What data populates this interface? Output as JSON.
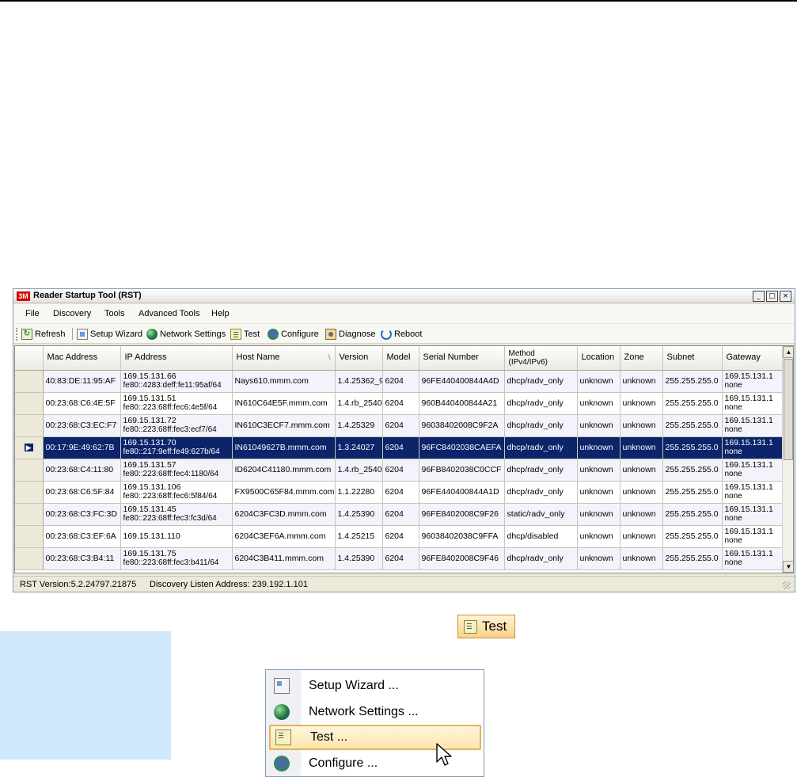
{
  "window": {
    "title": "Reader Startup Tool (RST)",
    "logo_text": "3M",
    "controls": {
      "minimize": "_",
      "maximize": "□",
      "close": "×"
    }
  },
  "menu": [
    "File",
    "Discovery",
    "Tools",
    "Advanced Tools",
    "Help"
  ],
  "toolbar": {
    "refresh": "Refresh",
    "setup_wizard": "Setup Wizard",
    "network_settings": "Network Settings",
    "test": "Test",
    "configure": "Configure",
    "diagnose": "Diagnose",
    "reboot": "Reboot"
  },
  "columns": [
    "Mac Address",
    "IP Address",
    "Host Name",
    "Version",
    "Model",
    "Serial Number",
    "Method (IPv4/IPv6)",
    "Location",
    "Zone",
    "Subnet",
    "Gateway"
  ],
  "rows": [
    {
      "mac": "40:83:DE:11:95:AF",
      "ip1": "169.15.131.66",
      "ip2": "fe80::4283:deff:fe11:95af/64",
      "host": "Nays610.mmm.com",
      "version": "1.4.25362_9",
      "model": "6204",
      "serial": "96FE440400844A4D",
      "method": "dhcp/radv_only",
      "location": "unknown",
      "zone": "unknown",
      "subnet": "255.255.255.0",
      "gw1": "169.15.131.1",
      "gw2": "none"
    },
    {
      "mac": "00:23:68:C6:4E:5F",
      "ip1": "169.15.131.51",
      "ip2": "fe80::223:68ff:fec6:4e5f/64",
      "host": "IN610C64E5F.mmm.com",
      "version": "1.4.rb_2540",
      "model": "6204",
      "serial": "960B440400844A21",
      "method": "dhcp/radv_only",
      "location": "unknown",
      "zone": "unknown",
      "subnet": "255.255.255.0",
      "gw1": "169.15.131.1",
      "gw2": "none"
    },
    {
      "mac": "00:23:68:C3:EC:F7",
      "ip1": "169.15.131.72",
      "ip2": "fe80::223:68ff:fec3:ecf7/64",
      "host": "IN610C3ECF7.mmm.com",
      "version": "1.4.25329",
      "model": "6204",
      "serial": "96038402008C9F2A",
      "method": "dhcp/radv_only",
      "location": "unknown",
      "zone": "unknown",
      "subnet": "255.255.255.0",
      "gw1": "169.15.131.1",
      "gw2": "none"
    },
    {
      "mac": "00:17:9E:49:62:7B",
      "ip1": "169.15.131.70",
      "ip2": "fe80::217:9eff:fe49:627b/64",
      "host": "IN61049627B.mmm.com",
      "version": "1.3.24027",
      "model": "6204",
      "serial": "96FC8402038CAEFA",
      "method": "dhcp/radv_only",
      "location": "unknown",
      "zone": "unknown",
      "subnet": "255.255.255.0",
      "gw1": "169.15.131.1",
      "gw2": "none"
    },
    {
      "mac": "00:23:68:C4:11:80",
      "ip1": "169.15.131.57",
      "ip2": "fe80::223:68ff:fec4:1180/64",
      "host": "ID6204C41180.mmm.com",
      "version": "1.4.rb_2540",
      "model": "6204",
      "serial": "96FB8402038C0CCF",
      "method": "dhcp/radv_only",
      "location": "unknown",
      "zone": "unknown",
      "subnet": "255.255.255.0",
      "gw1": "169.15.131.1",
      "gw2": "none"
    },
    {
      "mac": "00:23:68:C6:5F:84",
      "ip1": "169.15.131.106",
      "ip2": "fe80::223:68ff:fec6:5f84/64",
      "host": "FX9500C65F84.mmm.com",
      "version": "1.1.22280",
      "model": "6204",
      "serial": "96FE440400844A1D",
      "method": "dhcp/radv_only",
      "location": "unknown",
      "zone": "unknown",
      "subnet": "255.255.255.0",
      "gw1": "169.15.131.1",
      "gw2": "none"
    },
    {
      "mac": "00:23:68:C3:FC:3D",
      "ip1": "169.15.131.45",
      "ip2": "fe80::223:68ff:fec3:fc3d/64",
      "host": "6204C3FC3D.mmm.com",
      "version": "1.4.25390",
      "model": "6204",
      "serial": "96FE8402008C9F26",
      "method": "static/radv_only",
      "location": "unknown",
      "zone": "unknown",
      "subnet": "255.255.255.0",
      "gw1": "169.15.131.1",
      "gw2": "none"
    },
    {
      "mac": "00:23:68:C3:EF:6A",
      "ip1": "169.15.131.110",
      "ip2": "",
      "host": "6204C3EF6A.mmm.com",
      "version": "1.4.25215",
      "model": "6204",
      "serial": "96038402038C9FFA",
      "method": "dhcp/disabled",
      "location": "unknown",
      "zone": "unknown",
      "subnet": "255.255.255.0",
      "gw1": "169.15.131.1",
      "gw2": "none"
    },
    {
      "mac": "00:23:68:C3:B4:11",
      "ip1": "169.15.131.75",
      "ip2": "fe80::223:68ff:fec3:b411/64",
      "host": "6204C3B411.mmm.com",
      "version": "1.4.25390",
      "model": "6204",
      "serial": "96FE8402008C9F46",
      "method": "dhcp/radv_only",
      "location": "unknown",
      "zone": "unknown",
      "subnet": "255.255.255.0",
      "gw1": "169.15.131.1",
      "gw2": "none"
    }
  ],
  "selected_row": 3,
  "status": {
    "version": "RST Version:5.2.24797.21875",
    "discovery": "Discovery Listen Address: 239.192.1.101"
  },
  "callout": {
    "test_label": "Test"
  },
  "context_menu": {
    "items": [
      {
        "label": "Setup Wizard ...",
        "icon": "wizard-icon"
      },
      {
        "label": "Network Settings ...",
        "icon": "globe-icon"
      },
      {
        "label": "Test ...",
        "icon": "test-icon",
        "highlighted": true
      },
      {
        "label": "Configure ...",
        "icon": "configure-icon"
      }
    ]
  },
  "colors": {
    "selection": "#0b246a",
    "highlight_border": "#e2b35a",
    "side_panel": "#cfe8fb"
  }
}
